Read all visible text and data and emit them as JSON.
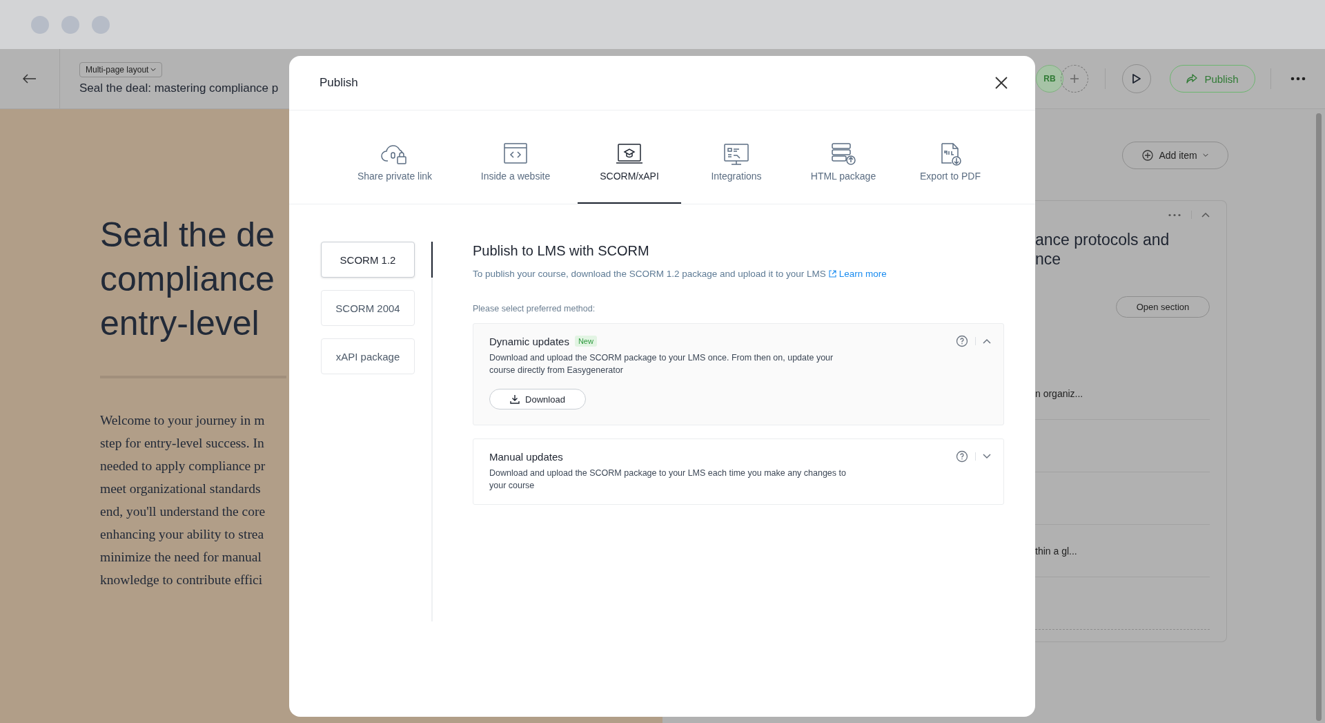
{
  "header": {
    "layout_dropdown": "Multi-page layout",
    "course_title": "Seal the deal: mastering compliance p",
    "avatar": "RB",
    "publish_button": "Publish"
  },
  "course": {
    "heading_lines": [
      "Seal the de",
      "compliance",
      "entry-level"
    ],
    "body_lines": [
      "Welcome to your journey in m",
      "step for entry-level success. In",
      "needed to apply compliance pr",
      "meet organizational standards",
      "end, you'll understand the core",
      "enhancing your ability to strea",
      "minimize the need for manual",
      "knowledge to contribute effici"
    ]
  },
  "outline": {
    "add_item": "Add item",
    "section_title_lines": [
      "ance protocols and",
      "nce"
    ],
    "open_section": "Open section",
    "item_texts": [
      "n organiz...",
      "thin a gl..."
    ]
  },
  "modal": {
    "title": "Publish",
    "tabs": [
      {
        "label": "Share private link",
        "selected": false
      },
      {
        "label": "Inside a website",
        "selected": false
      },
      {
        "label": "SCORM/xAPI",
        "selected": true
      },
      {
        "label": "Integrations",
        "selected": false
      },
      {
        "label": "HTML package",
        "selected": false
      },
      {
        "label": "Export to PDF",
        "selected": false
      }
    ],
    "formats": [
      {
        "label": "SCORM 1.2",
        "selected": true
      },
      {
        "label": "SCORM 2004",
        "selected": false
      },
      {
        "label": "xAPI package",
        "selected": false
      }
    ],
    "content": {
      "title": "Publish to LMS with SCORM",
      "description": "To publish your course, download the SCORM 1.2 package and upload it to your LMS",
      "link": "Learn more",
      "prompt": "Please select preferred method:",
      "methods": [
        {
          "title": "Dynamic updates",
          "badge": "New",
          "description": "Download and upload the SCORM package to your LMS once. From then on, update your course directly from Easygenerator",
          "expanded": true,
          "button": "Download"
        },
        {
          "title": "Manual updates",
          "description": "Download and upload the SCORM package to your LMS each time you make any changes to your course",
          "expanded": false
        }
      ]
    }
  }
}
